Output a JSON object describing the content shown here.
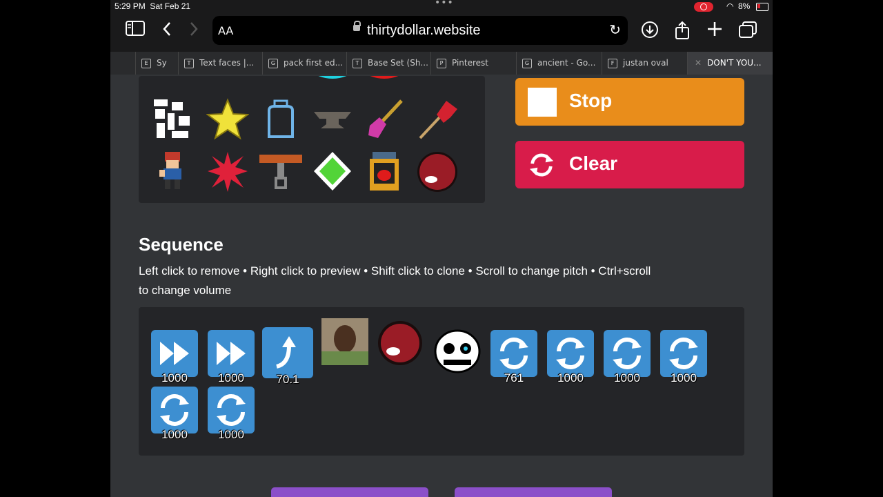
{
  "status": {
    "time": "5:29 PM",
    "date": "Sat Feb 21",
    "battery": "8%"
  },
  "browser": {
    "aa": "AA",
    "url": "thirtydollar.website"
  },
  "tabs": [
    {
      "fav": "E",
      "label": "Sy"
    },
    {
      "fav": "T",
      "label": "Text faces |..."
    },
    {
      "fav": "G",
      "label": "pack first ed..."
    },
    {
      "fav": "T",
      "label": "Base Set (Sh..."
    },
    {
      "fav": "P",
      "label": "Pinterest"
    },
    {
      "fav": "G",
      "label": "ancient - Go..."
    },
    {
      "fav": "F",
      "label": "justan oval"
    },
    {
      "fav": "",
      "label": "DON'T YOU..."
    }
  ],
  "controls": {
    "stop_label": "Stop",
    "clear_label": "Clear"
  },
  "sequence": {
    "title": "Sequence",
    "instructions": "Left click to remove • Right click to preview • Shift click to clone • Scroll to change pitch • Ctrl+scroll to change volume",
    "tiles": [
      {
        "icon": "fast-forward-icon",
        "value": "1000"
      },
      {
        "icon": "fast-forward-icon",
        "value": "1000"
      },
      {
        "icon": "jump-arrow-icon",
        "value": "70.1"
      },
      {
        "icon": "photo-face-icon",
        "value": ""
      },
      {
        "icon": "amogus-icon",
        "value": ""
      },
      {
        "icon": "sans-skull-icon",
        "value": ""
      },
      {
        "icon": "loop-icon",
        "value": "761"
      },
      {
        "icon": "loop-icon",
        "value": "1000"
      },
      {
        "icon": "loop-icon",
        "value": "1000"
      },
      {
        "icon": "loop-icon",
        "value": "1000"
      },
      {
        "icon": "loop-icon",
        "value": "1000"
      },
      {
        "icon": "loop-icon",
        "value": "1000"
      }
    ]
  },
  "colors": {
    "stop": "#e98d1b",
    "clear": "#d81c4a",
    "tile": "#3d8fd1",
    "bg": "#323437",
    "panel": "#242528"
  }
}
